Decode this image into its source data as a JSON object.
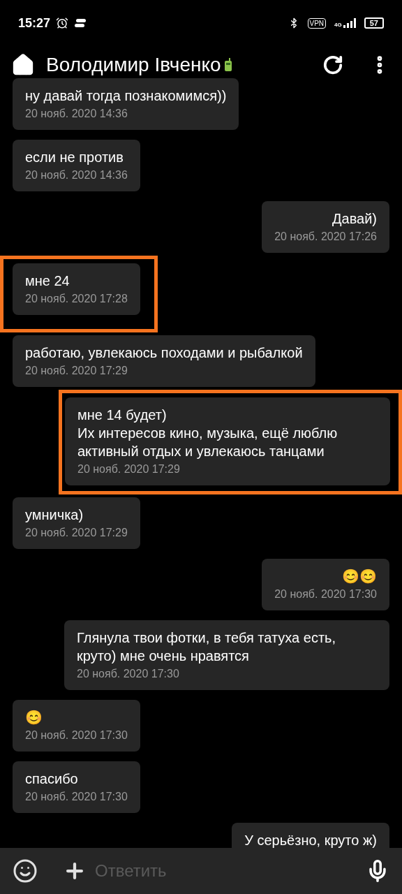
{
  "status_bar": {
    "time": "15:27",
    "vpn": "VPN",
    "network": "4G",
    "battery": "57"
  },
  "header": {
    "title": "Володимир Івченко"
  },
  "messages": [
    {
      "kind": "incoming",
      "text": "ну давай тогда познакомимся))",
      "timestamp": "20 нояб. 2020 14:36",
      "highlighted": false
    },
    {
      "kind": "incoming",
      "text": "если не против",
      "timestamp": "20 нояб. 2020 14:36",
      "highlighted": false
    },
    {
      "kind": "outgoing",
      "text": "Давай)",
      "timestamp": "20 нояб. 2020 17:26",
      "highlighted": false
    },
    {
      "kind": "incoming",
      "text": "мне 24",
      "timestamp": "20 нояб. 2020 17:28",
      "highlighted": true
    },
    {
      "kind": "incoming",
      "text": "работаю, увлекаюсь походами и рыбалкой",
      "timestamp": "20 нояб. 2020 17:29",
      "highlighted": false
    },
    {
      "kind": "outgoing",
      "text": "мне 14 будет)\nИх интересов кино, музыка, ещё люблю активный отдых и увлекаюсь танцами",
      "timestamp": "20 нояб. 2020 17:29",
      "highlighted": true
    },
    {
      "kind": "incoming",
      "text": "умничка)",
      "timestamp": "20 нояб. 2020 17:29",
      "highlighted": false
    },
    {
      "kind": "outgoing",
      "text": "😊😊",
      "timestamp": "20 нояб. 2020 17:30",
      "highlighted": false
    },
    {
      "kind": "outgoing",
      "text": "Глянула твои фотки, в тебя татуха есть, круто) мне очень нравятся",
      "timestamp": "20 нояб. 2020 17:30",
      "highlighted": false
    },
    {
      "kind": "incoming",
      "text": "😊",
      "timestamp": "20 нояб. 2020 17:30",
      "highlighted": false
    },
    {
      "kind": "incoming",
      "text": "спасибо",
      "timestamp": "20 нояб. 2020 17:30",
      "highlighted": false
    },
    {
      "kind": "outgoing",
      "text": "У серьёзно, круто ж)",
      "highlighted": false
    }
  ],
  "composer": {
    "placeholder": "Ответить"
  }
}
